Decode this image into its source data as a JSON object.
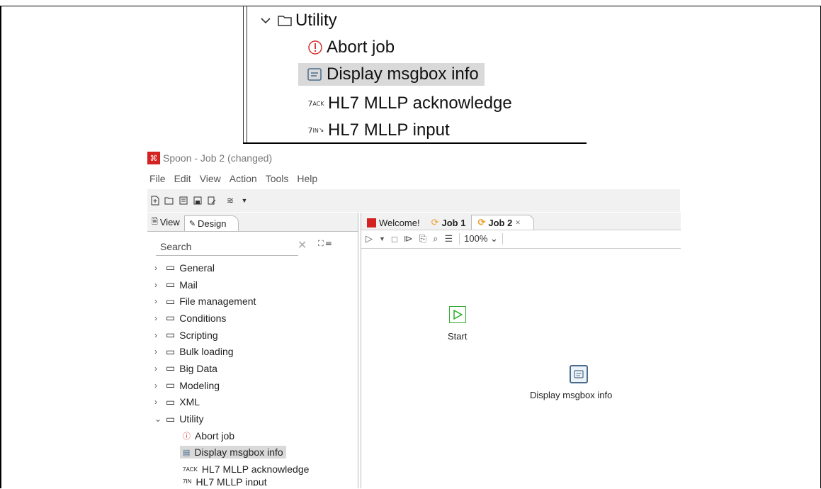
{
  "zoom_callout": {
    "items": [
      {
        "label": "Utility",
        "type": "folder",
        "expanded": true
      },
      {
        "label": "Abort job",
        "icon": "abort-icon"
      },
      {
        "label": "Display msgbox info",
        "icon": "msgbox-icon",
        "selected": true
      },
      {
        "label": "HL7 MLLP acknowledge",
        "icon": "hl7-ack-icon"
      },
      {
        "label": "HL7 MLLP input",
        "icon": "hl7-input-icon"
      }
    ]
  },
  "window": {
    "title": "Spoon - Job 2 (changed)",
    "menu": [
      "File",
      "Edit",
      "View",
      "Action",
      "Tools",
      "Help"
    ]
  },
  "left_panel": {
    "tabs": [
      "View",
      "Design"
    ],
    "search_placeholder": "Search",
    "tree": [
      "General",
      "Mail",
      "File management",
      "Conditions",
      "Scripting",
      "Bulk loading",
      "Big Data",
      "Modeling",
      "XML",
      "Utility"
    ],
    "utility_children": [
      "Abort job",
      "Display msgbox info",
      "HL7 MLLP acknowledge",
      "HL7 MLLP input"
    ]
  },
  "right_panel": {
    "tabs": [
      "Welcome!",
      "Job 1",
      "Job 2"
    ],
    "zoom": "100%",
    "nodes": {
      "start": "Start",
      "msgbox": "Display msgbox info"
    }
  },
  "colors": {
    "accent_red": "#d42121",
    "selection": "#d9d9d9",
    "start_green": "#22aa22"
  }
}
